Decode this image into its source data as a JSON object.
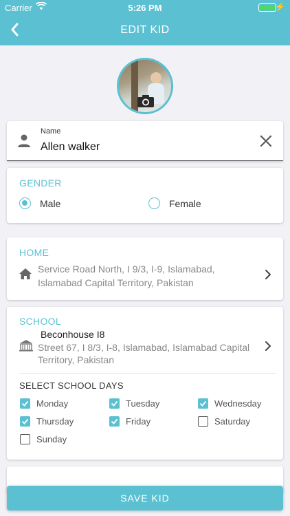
{
  "status": {
    "carrier": "Carrier",
    "time": "5:26 PM"
  },
  "nav": {
    "title": "EDIT KID",
    "back_icon": "chevron-left-icon"
  },
  "avatar": {
    "camera_icon": "camera-icon"
  },
  "name_field": {
    "label": "Name",
    "value": "Allen walker",
    "clear_icon": "close-icon"
  },
  "gender": {
    "title": "GENDER",
    "options": [
      {
        "label": "Male",
        "selected": true
      },
      {
        "label": "Female",
        "selected": false
      }
    ]
  },
  "home": {
    "title": "HOME",
    "address_line1": "Service Road North, I 9/3, I-9, Islamabad,",
    "address_line2": "Islamabad Capital Territory, Pakistan"
  },
  "school": {
    "title": "SCHOOL",
    "name": "Beconhouse I8",
    "address_line1": "Street 67, I 8/3, I-8, Islamabad, Islamabad Capital",
    "address_line2": "Territory, Pakistan",
    "days_title": "SELECT SCHOOL DAYS",
    "days": [
      {
        "label": "Monday",
        "checked": true
      },
      {
        "label": "Tuesday",
        "checked": true
      },
      {
        "label": "Wednesday",
        "checked": true
      },
      {
        "label": "Thursday",
        "checked": true
      },
      {
        "label": "Friday",
        "checked": true
      },
      {
        "label": "Saturday",
        "checked": false
      },
      {
        "label": "Sunday",
        "checked": false
      }
    ]
  },
  "save_button": "SAVE KID",
  "colors": {
    "accent": "#5bc0d2",
    "battery": "#4cd964"
  }
}
